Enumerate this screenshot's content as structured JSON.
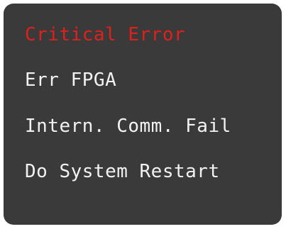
{
  "dialog": {
    "title": "Critical Error",
    "lines": [
      "Err FPGA",
      "Intern. Comm. Fail",
      "Do System Restart"
    ]
  },
  "colors": {
    "background": "#3a3a3a",
    "title_text": "#e0201c",
    "body_text": "#f2f2f2"
  }
}
